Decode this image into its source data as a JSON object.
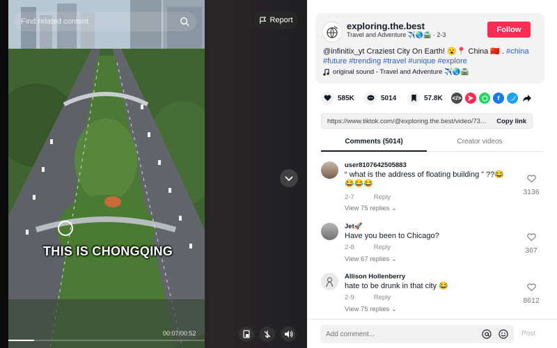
{
  "video": {
    "search_placeholder": "Find related content",
    "report_label": "Report",
    "caption": "THIS IS CHONGQING",
    "time": "00:07/00:52",
    "progress": 0.13
  },
  "author": {
    "username": "exploring.the.best",
    "subline": "Travel and Adventure ✈️🌏🛣️ · 2-3",
    "follow_label": "Follow"
  },
  "description": {
    "mention": "@infinitix_yt",
    "text": " Craziest City On Earth! 😮📍 China 🇨🇳 . ",
    "tags": [
      "#china",
      "#future",
      "#trending",
      "#travel",
      "#unique",
      "#explore"
    ]
  },
  "music": "original sound - Travel and Adventure ✈️🌏🛣️",
  "stats": {
    "likes": "585K",
    "comments": "5014",
    "saves": "57.8K"
  },
  "share": {
    "url": "https://www.tiktok.com/@exploring.the.best/video/73...",
    "copy_label": "Copy link"
  },
  "tabs": {
    "comments": "Comments (5014)",
    "creator": "Creator videos"
  },
  "comments": [
    {
      "user": "user8107642505883",
      "text": "“ what is the address of floating building ” ??😂😂😂😂",
      "date": "2-7",
      "reply": "Reply",
      "replies": "View 75 replies",
      "likes": "3136"
    },
    {
      "user": "Jet🚀",
      "text": "Have you been to Chicago?",
      "date": "2-8",
      "reply": "Reply",
      "replies": "View 67 replies",
      "likes": "367"
    },
    {
      "user": "Allison Hollenberry",
      "text": "hate to be drunk in that city 😂",
      "date": "2-9",
      "reply": "Reply",
      "replies": "View 75 replies",
      "likes": "8612"
    }
  ],
  "footer": {
    "placeholder": "Add comment...",
    "post_label": "Post"
  },
  "colors": {
    "brand": "#fe2c55",
    "hashtag": "#2b5db9"
  }
}
